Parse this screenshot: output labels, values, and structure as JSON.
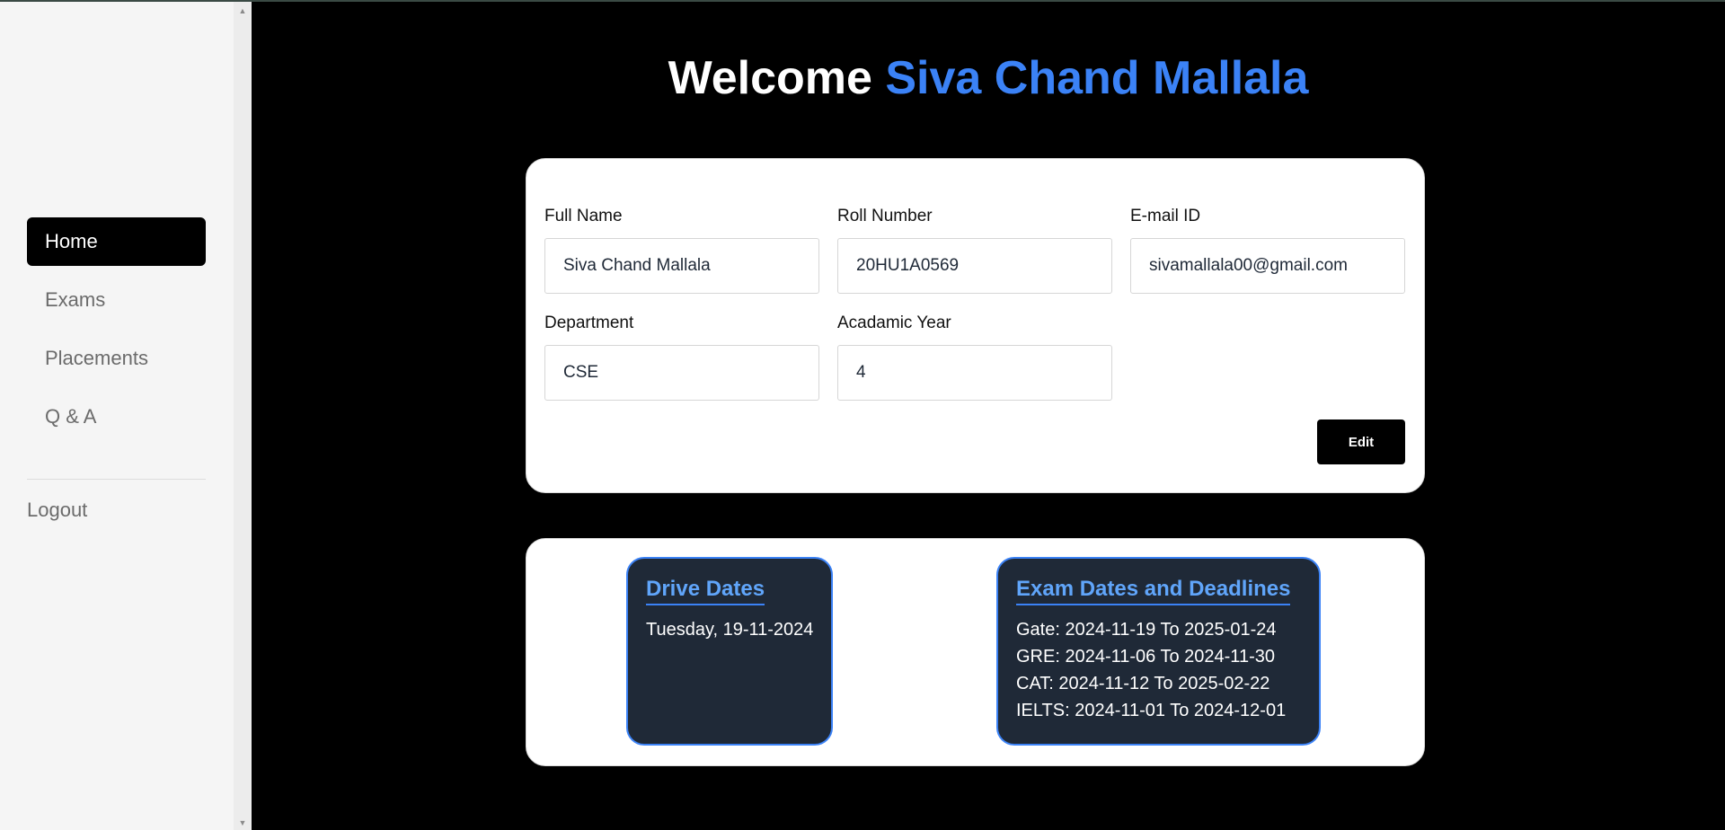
{
  "sidebar": {
    "nav": [
      "Home",
      "Exams",
      "Placements",
      "Q & A"
    ],
    "logout": "Logout"
  },
  "header": {
    "welcome": "Welcome",
    "name": "Siva Chand Mallala"
  },
  "profile": {
    "full_name_label": "Full Name",
    "full_name_value": "Siva Chand Mallala",
    "roll_label": "Roll Number",
    "roll_value": "20HU1A0569",
    "email_label": "E-mail ID",
    "email_value": "sivamallala00@gmail.com",
    "department_label": "Department",
    "department_value": "CSE",
    "year_label": "Acadamic Year",
    "year_value": "4",
    "edit_label": "Edit"
  },
  "drive": {
    "title": "Drive Dates",
    "dates": [
      "Tuesday, 19-11-2024"
    ]
  },
  "exams": {
    "title": "Exam Dates and Deadlines",
    "items": [
      "Gate: 2024-11-19 To 2025-01-24",
      "GRE: 2024-11-06 To 2024-11-30",
      "CAT: 2024-11-12 To 2025-02-22",
      "IELTS: 2024-11-01 To 2024-12-01"
    ]
  },
  "colors": {
    "accent": "#3b82f6",
    "panel_bg": "#1f2937",
    "page_bg": "#000000"
  }
}
